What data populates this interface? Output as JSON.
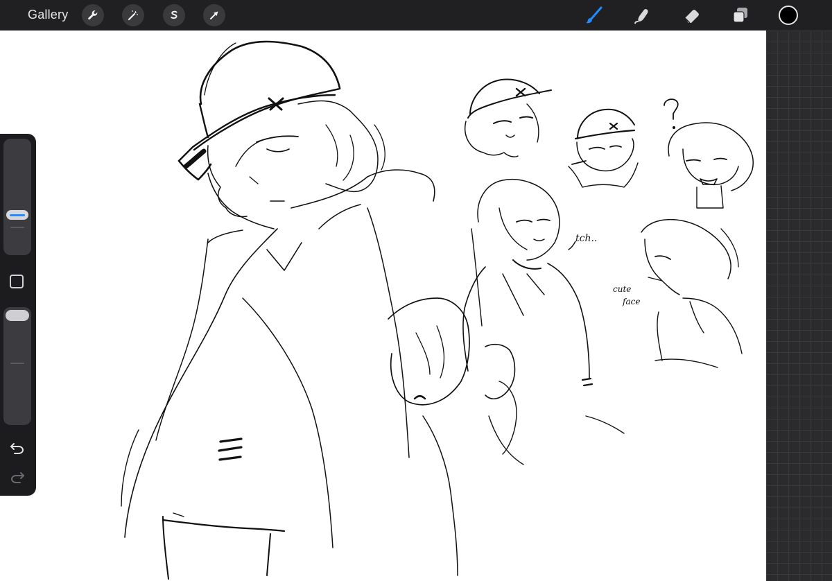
{
  "toolbar": {
    "gallery_label": "Gallery",
    "left_tools": [
      "wrench-icon",
      "magic-wand-icon",
      "selection-icon",
      "transform-arrow-icon"
    ],
    "right_tools": [
      "brush-icon",
      "smudge-icon",
      "eraser-icon",
      "layers-icon",
      "color-swatch"
    ],
    "active_tool": "brush",
    "accent_color": "#1f8cff",
    "current_color": "#000000"
  },
  "sidebar": {
    "brush_size_level": 0.65,
    "opacity_level": 1.0,
    "modifier": "square-icon",
    "undo": "undo-icon",
    "redo": "redo-icon"
  },
  "canvas": {
    "annotations": [
      "tch..",
      "cute",
      "face",
      "?"
    ]
  }
}
